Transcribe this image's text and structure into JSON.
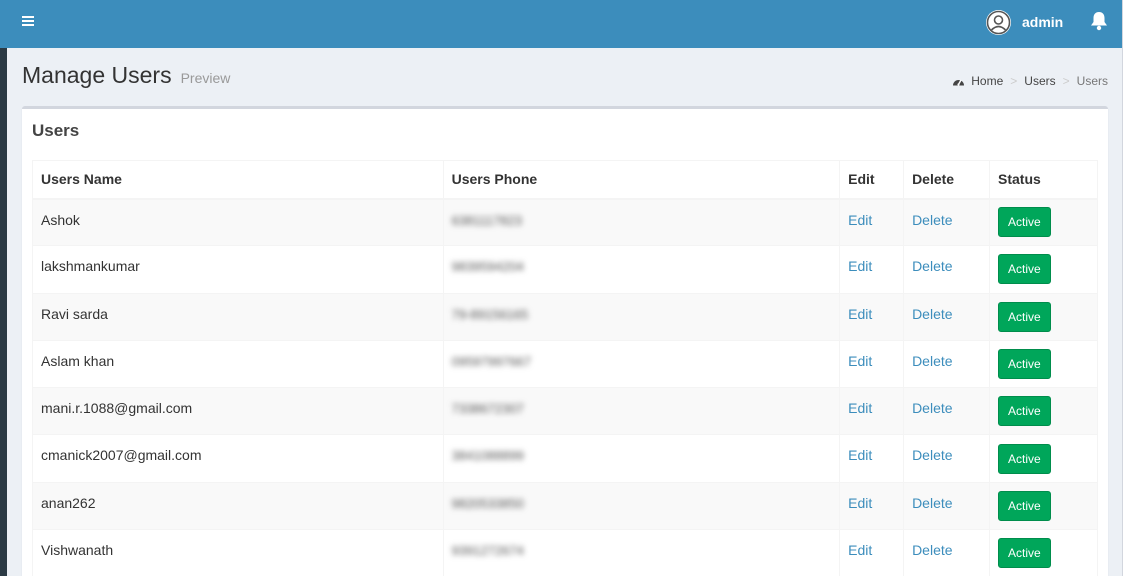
{
  "header": {
    "user_name": "admin",
    "icons": {
      "menu": "hamburger-icon",
      "avatar": "user-circle-icon",
      "notifications": "bell-icon"
    },
    "brand_color": "#3c8dbc"
  },
  "page": {
    "title": "Manage Users",
    "subtitle": "Preview"
  },
  "breadcrumb": {
    "icon": "dashboard-icon",
    "items": [
      "Home",
      "Users",
      "Users"
    ],
    "separator": ">"
  },
  "box": {
    "title": "Users"
  },
  "table": {
    "columns": [
      "Users Name",
      "Users Phone",
      "Edit",
      "Delete",
      "Status"
    ],
    "rows": [
      {
        "name": "Ashok",
        "phone": "6381117823",
        "edit": "Edit",
        "delete": "Delete",
        "status": "Active"
      },
      {
        "name": "lakshmankumar",
        "phone": "9839594204",
        "edit": "Edit",
        "delete": "Delete",
        "status": "Active"
      },
      {
        "name": "Ravi sarda",
        "phone": "79-89156165",
        "edit": "Edit",
        "delete": "Delete",
        "status": "Active"
      },
      {
        "name": "Aslam khan",
        "phone": "09597997667",
        "edit": "Edit",
        "delete": "Delete",
        "status": "Active"
      },
      {
        "name": "mani.r.1088@gmail.com",
        "phone": "7338672307",
        "edit": "Edit",
        "delete": "Delete",
        "status": "Active"
      },
      {
        "name": "cmanick2007@gmail.com",
        "phone": "3841088899",
        "edit": "Edit",
        "delete": "Delete",
        "status": "Active"
      },
      {
        "name": "anan262",
        "phone": "9820533850",
        "edit": "Edit",
        "delete": "Delete",
        "status": "Active"
      },
      {
        "name": "Vishwanath",
        "phone": "9391272674",
        "edit": "Edit",
        "delete": "Delete",
        "status": "Active"
      }
    ],
    "status_color": "#00a65a",
    "link_color": "#3c8dbc"
  }
}
